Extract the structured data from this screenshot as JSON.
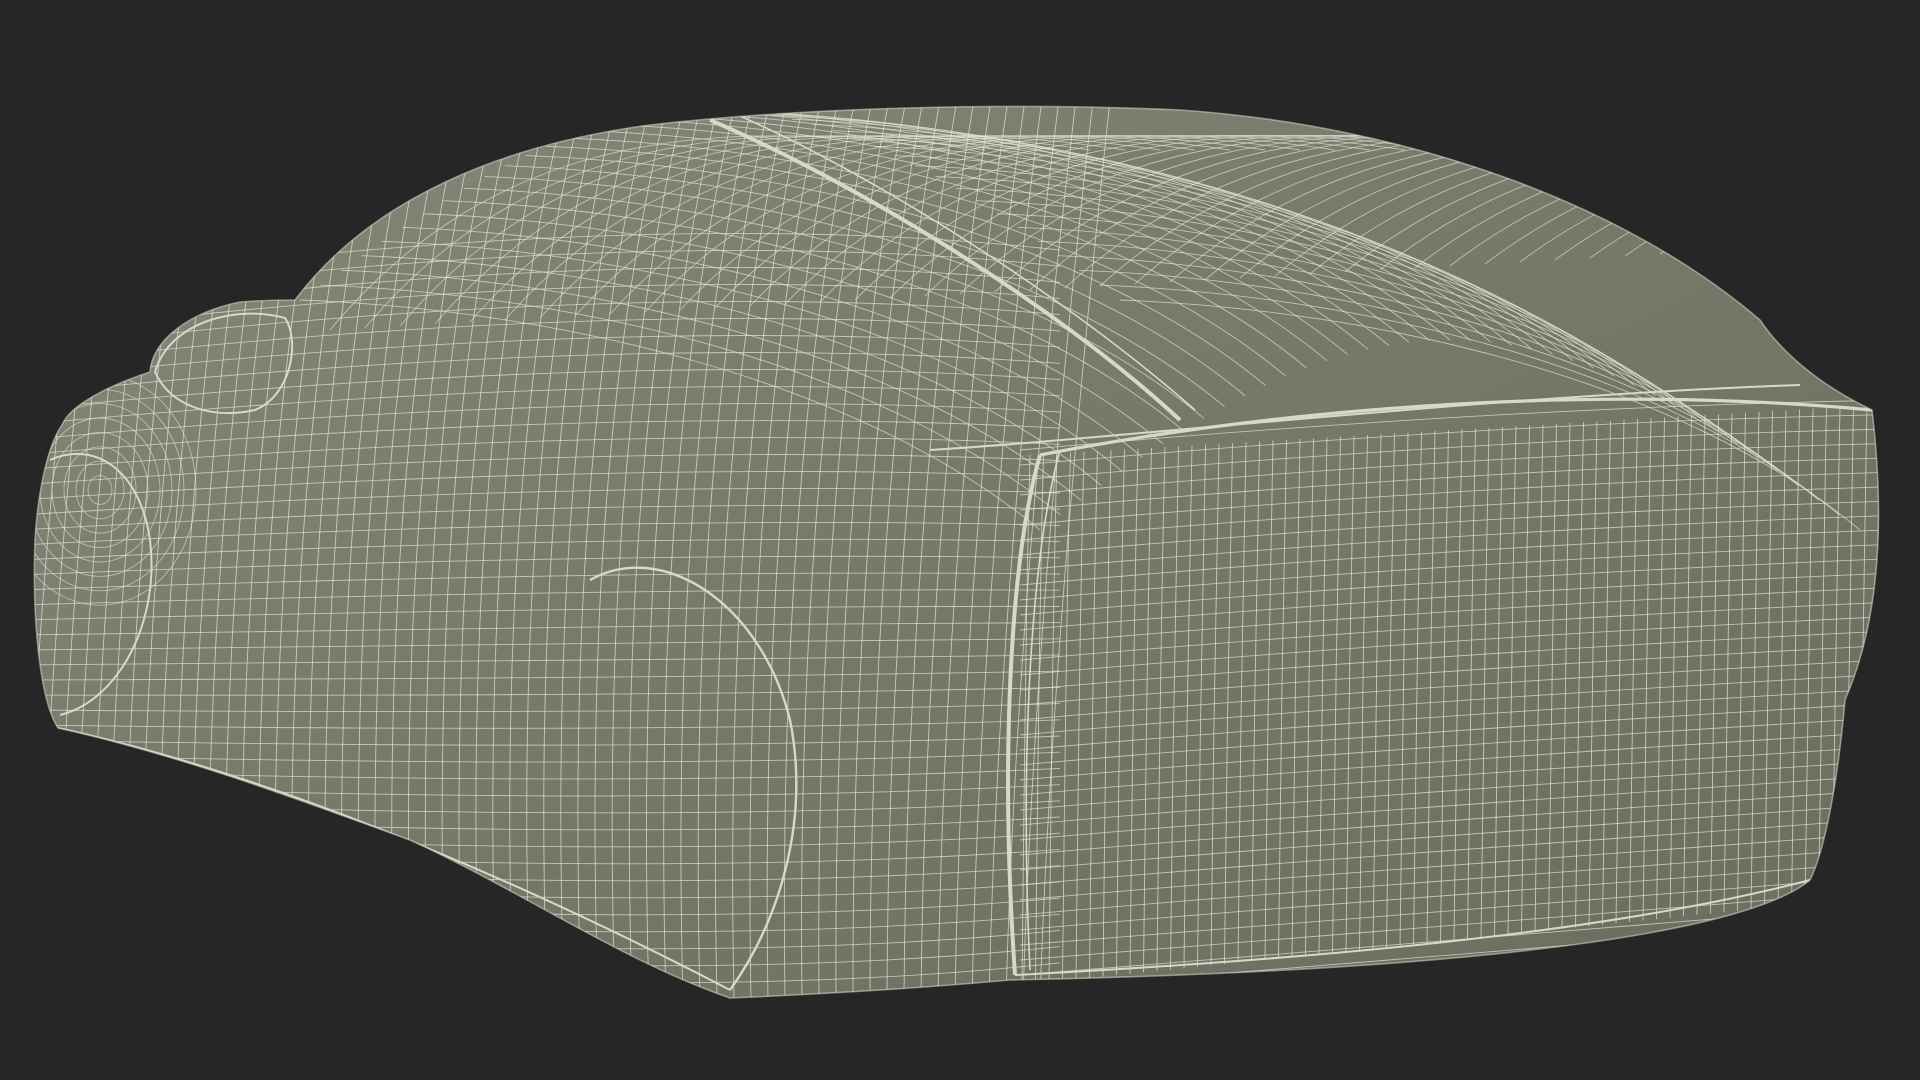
{
  "scene": {
    "background_color": "#262626",
    "surface_color": "#787869",
    "surface_shade_color": "#6c6c5f",
    "surface_highlight_color": "#86867a",
    "wire_color": "#e6e6d8",
    "edge_color": "#d8d8c8"
  }
}
